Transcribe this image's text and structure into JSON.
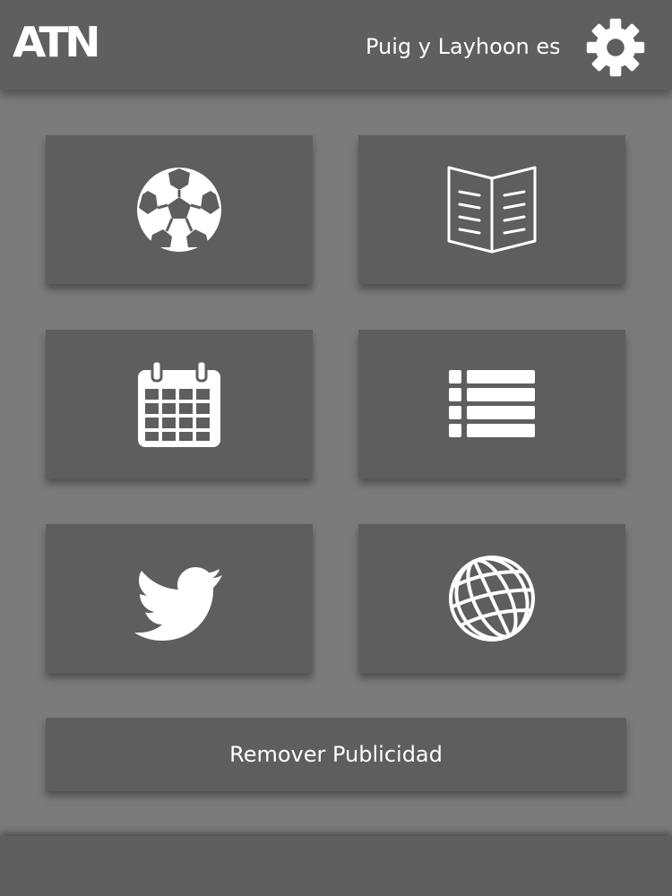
{
  "header": {
    "logo_text": "ATN",
    "ticker_text": "Puig y Layhoon es",
    "settings_icon": "gear-icon"
  },
  "tiles": [
    {
      "icon": "soccer-ball-icon"
    },
    {
      "icon": "book-icon"
    },
    {
      "icon": "calendar-icon"
    },
    {
      "icon": "list-icon"
    },
    {
      "icon": "twitter-bird-icon"
    },
    {
      "icon": "globe-icon"
    }
  ],
  "remove_ads": {
    "label": "Remover Publicidad"
  },
  "colors": {
    "background": "#7b7b7b",
    "bar": "#5f5f60",
    "tile": "#5e5e5f",
    "foreground": "#ffffff"
  }
}
